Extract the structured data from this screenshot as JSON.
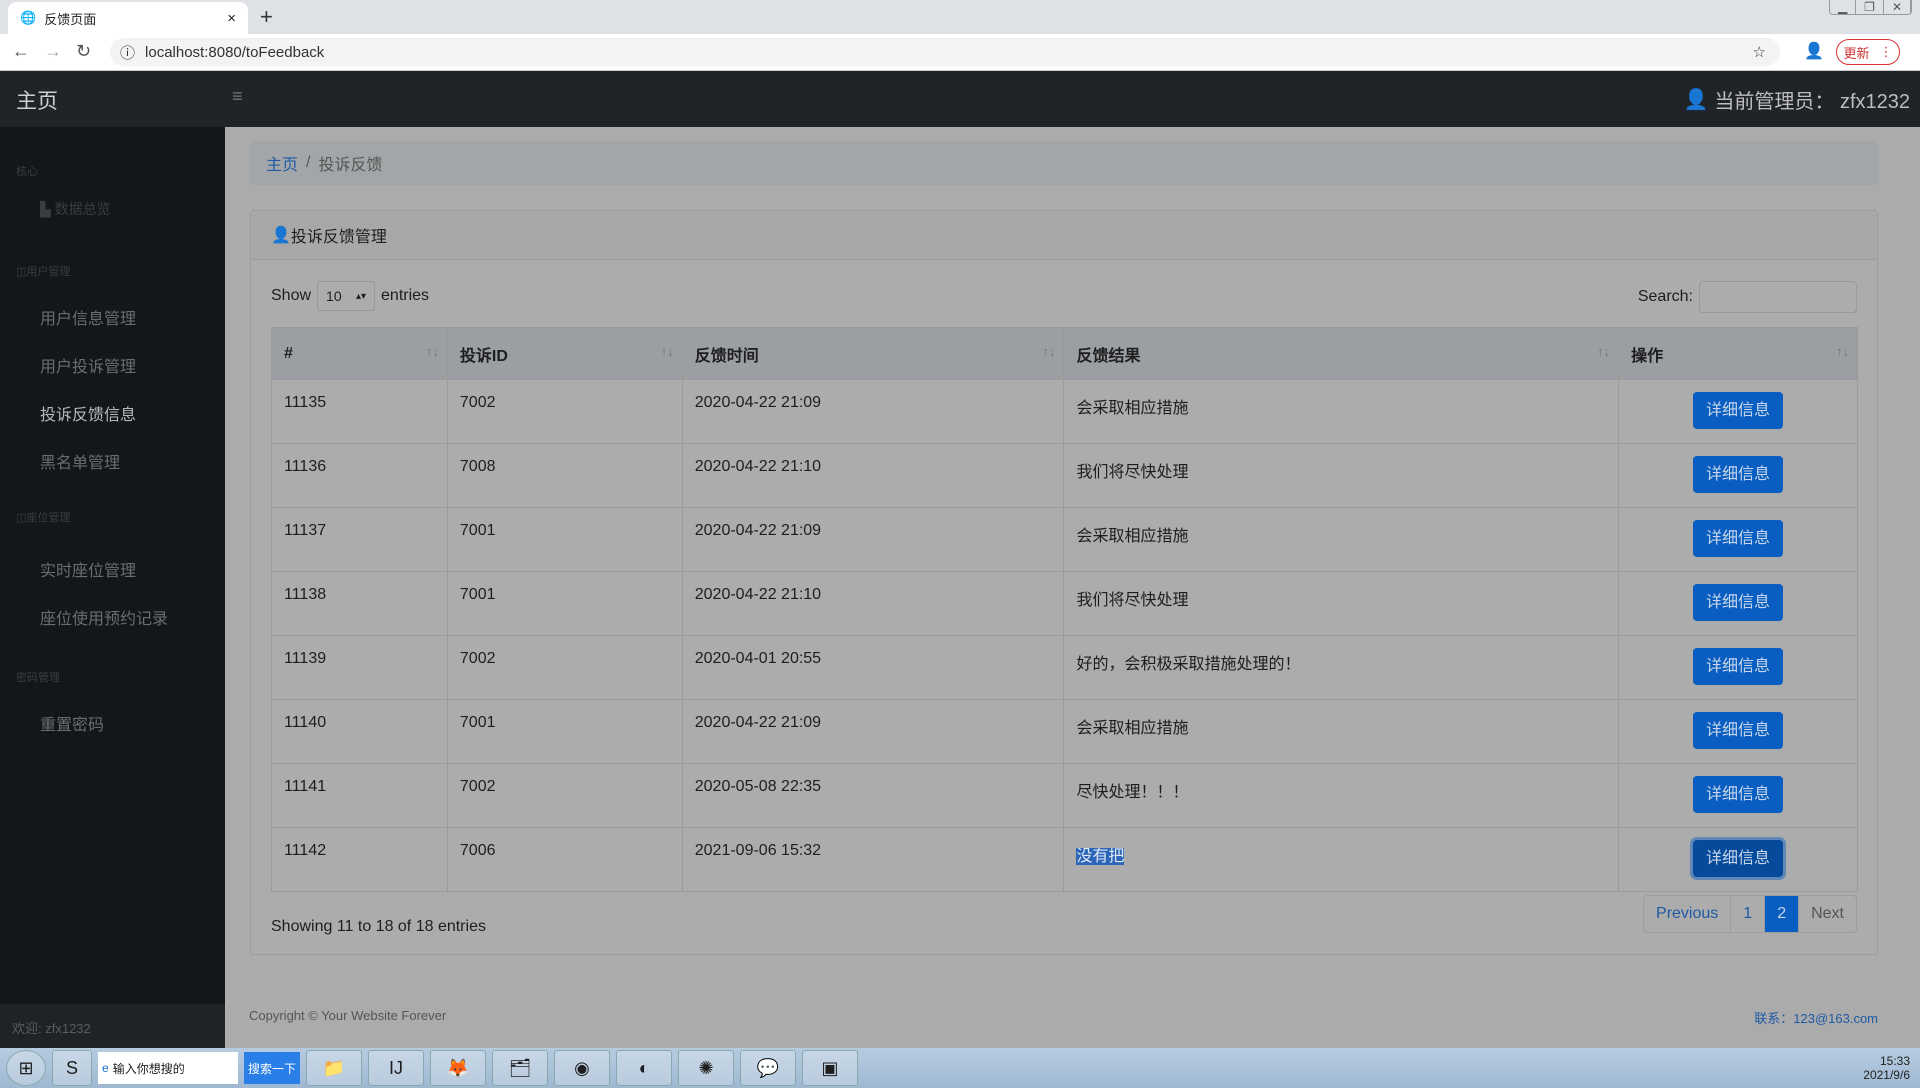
{
  "browser": {
    "tab_title": "反馈页面",
    "url": "localhost:8080/toFeedback",
    "update_label": "更新"
  },
  "navbar": {
    "brand": "主页",
    "admin_label": "当前管理员： zfx1232"
  },
  "sidebar": {
    "sections": [
      {
        "heading": "核心",
        "items": [
          {
            "label": "数据总览",
            "icon": "chart-area-icon"
          }
        ]
      },
      {
        "heading": "用户管理",
        "items": [
          {
            "label": "用户信息管理"
          },
          {
            "label": "用户投诉管理"
          },
          {
            "label": "投诉反馈信息",
            "active": true
          },
          {
            "label": "黑名单管理"
          }
        ]
      },
      {
        "heading": "座位管理",
        "items": [
          {
            "label": "实时座位管理"
          },
          {
            "label": "座位使用预约记录"
          }
        ]
      },
      {
        "heading": "密码管理",
        "items": [
          {
            "label": "重置密码"
          }
        ]
      }
    ],
    "footer": "欢迎: zfx1232"
  },
  "breadcrumb": {
    "home": "主页",
    "separator": "/",
    "current": "投诉反馈"
  },
  "card": {
    "title": "投诉反馈管理"
  },
  "table_controls": {
    "show": "Show",
    "page_length": "10",
    "entries": "entries",
    "search_label": "Search:",
    "search_value": ""
  },
  "table": {
    "columns": [
      "#",
      "投诉ID",
      "反馈时间",
      "反馈结果",
      "操作"
    ],
    "rows": [
      {
        "no": "11135",
        "cid": "7002",
        "time": "2020-04-22 21:09",
        "result": "会采取相应措施",
        "action": "详细信息"
      },
      {
        "no": "11136",
        "cid": "7008",
        "time": "2020-04-22 21:10",
        "result": "我们将尽快处理",
        "action": "详细信息"
      },
      {
        "no": "11137",
        "cid": "7001",
        "time": "2020-04-22 21:09",
        "result": "会采取相应措施",
        "action": "详细信息"
      },
      {
        "no": "11138",
        "cid": "7001",
        "time": "2020-04-22 21:10",
        "result": "我们将尽快处理",
        "action": "详细信息"
      },
      {
        "no": "11139",
        "cid": "7002",
        "time": "2020-04-01 20:55",
        "result": "好的，会积极采取措施处理的！",
        "action": "详细信息"
      },
      {
        "no": "11140",
        "cid": "7001",
        "time": "2020-04-22 21:09",
        "result": "会采取相应措施",
        "action": "详细信息"
      },
      {
        "no": "11141",
        "cid": "7002",
        "time": "2020-05-08 22:35",
        "result": "尽快处理！！！",
        "action": "详细信息"
      },
      {
        "no": "11142",
        "cid": "7006",
        "time": "2021-09-06 15:32",
        "result": "没有把",
        "action": "详细信息"
      }
    ]
  },
  "info": "Showing 11 to 18 of 18 entries",
  "pagination": {
    "previous": "Previous",
    "pages": [
      "1",
      "2"
    ],
    "current": "2",
    "next": "Next"
  },
  "footer": {
    "copyright": "Copyright © Your Website Forever",
    "contact": "联系：123@163.com"
  },
  "taskbar": {
    "search_placeholder": "输入你想搜的",
    "search_button": "搜索一下",
    "clock_time": "15:33",
    "clock_date": "2021/9/6"
  },
  "colors": {
    "primary": "#0a5ec2",
    "navbar": "#202327",
    "sidebar": "#14171a"
  }
}
